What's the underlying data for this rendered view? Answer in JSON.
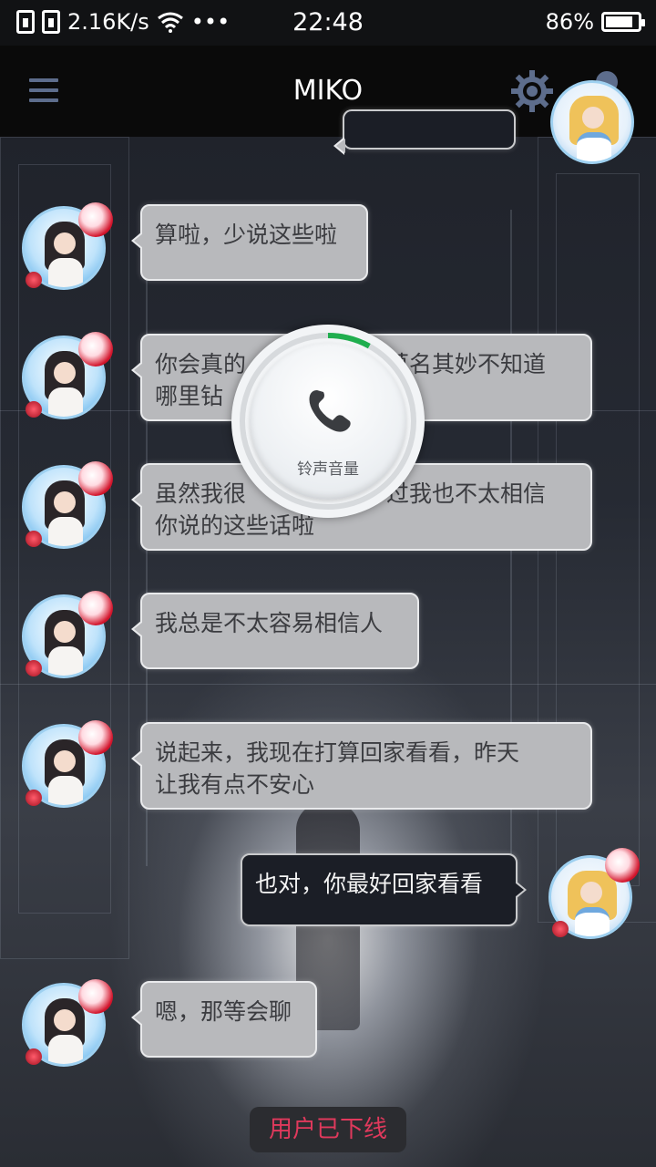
{
  "status_bar": {
    "network_speed": "2.16K/s",
    "more": "•••",
    "time": "22:48",
    "battery": "86%",
    "battery_level": 0.86
  },
  "header": {
    "title": "MIKO"
  },
  "messages": [
    {
      "sender": "other",
      "text": "算啦，少说这些啦"
    },
    {
      "sender": "other",
      "text": "你会真的莫名其妙不知道哪里钻出来"
    },
    {
      "sender": "other",
      "text": "虽然我很感谢你，不过我也不太相信你说的这些话啦"
    },
    {
      "sender": "other",
      "text": "我总是不太容易相信人"
    },
    {
      "sender": "other",
      "text": "说起来，我现在打算回家看看，昨天让我有点不安心"
    },
    {
      "sender": "me",
      "text": "也对，你最好回家看看"
    },
    {
      "sender": "other",
      "text": "嗯，那等会聊"
    }
  ],
  "visible_fragments": {
    "msg2_line1_left": "你会真的",
    "msg2_line1_right": "莫名其妙不知道",
    "msg2_line2_left": "哪里钻",
    "msg3_line1_left": "虽然我很",
    "msg3_line1_right": "过我也不太相信",
    "msg3_line2": "你说的这些话啦",
    "msg5_line1": "说起来，我现在打算回家看看，昨天",
    "msg5_line2": "让我有点不安心"
  },
  "volume_overlay": {
    "label": "铃声音量",
    "level": 0.08,
    "accent_color": "#1fae4e"
  },
  "toast": {
    "text": "用户已下线"
  },
  "colors": {
    "header_bg": "#0a0a0a",
    "icon_blue": "#5d6d8c",
    "bubble_other": "#b8b9bc",
    "bubble_mine": "#1b1e26",
    "toast_text": "#e0395c"
  },
  "icons": {
    "menu": "menu-icon",
    "settings": "gear-icon",
    "profile": "user-icon",
    "phone": "phone-icon"
  }
}
